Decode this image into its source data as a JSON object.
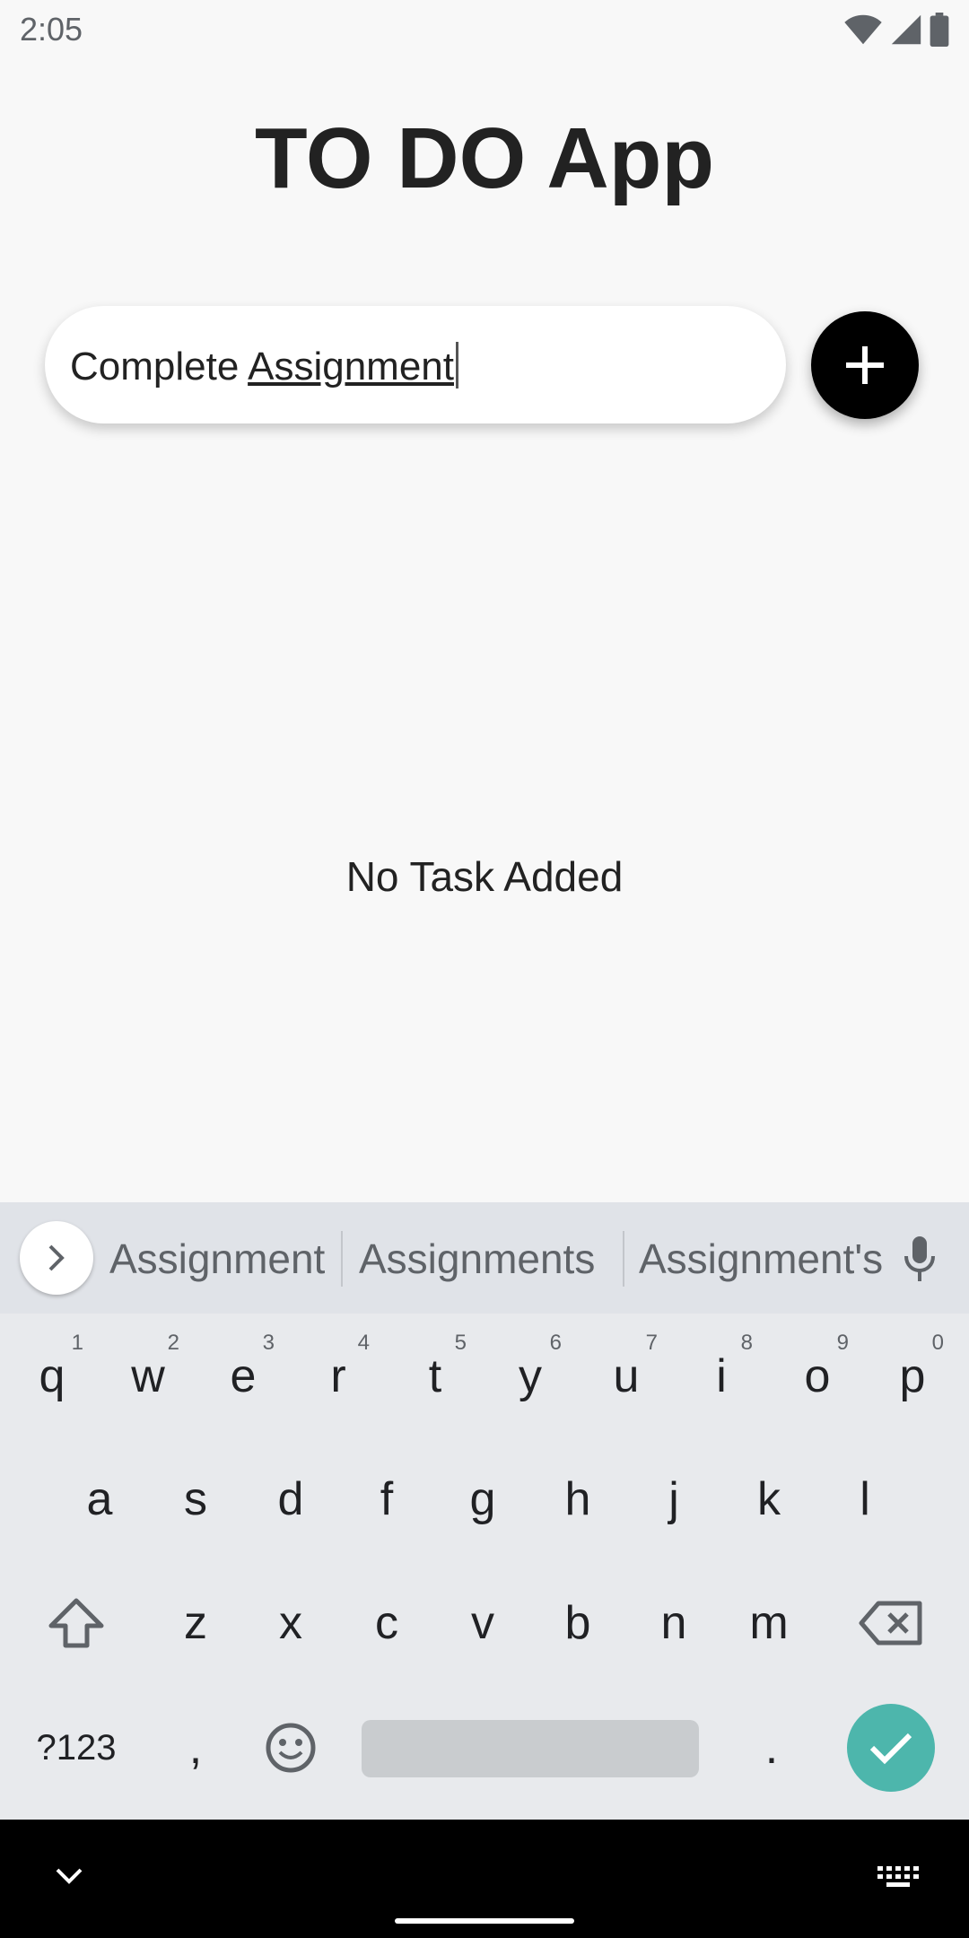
{
  "status_bar": {
    "time": "2:05",
    "icons": [
      "wifi-icon",
      "signal-icon",
      "battery-icon"
    ]
  },
  "app": {
    "title": "TO DO App",
    "input": {
      "typed_prefix": "Complete ",
      "composing_word": "Assignment"
    },
    "add_button_icon": "plus-icon",
    "empty_message": "No Task Added"
  },
  "keyboard": {
    "suggestions": [
      "Assignment",
      "Assignments",
      "Assignment's"
    ],
    "row1": [
      {
        "key": "q",
        "hint": "1"
      },
      {
        "key": "w",
        "hint": "2"
      },
      {
        "key": "e",
        "hint": "3"
      },
      {
        "key": "r",
        "hint": "4"
      },
      {
        "key": "t",
        "hint": "5"
      },
      {
        "key": "y",
        "hint": "6"
      },
      {
        "key": "u",
        "hint": "7"
      },
      {
        "key": "i",
        "hint": "8"
      },
      {
        "key": "o",
        "hint": "9"
      },
      {
        "key": "p",
        "hint": "0"
      }
    ],
    "row2": [
      "a",
      "s",
      "d",
      "f",
      "g",
      "h",
      "j",
      "k",
      "l"
    ],
    "row3": [
      "z",
      "x",
      "c",
      "v",
      "b",
      "n",
      "m"
    ],
    "symbols_label": "?123",
    "comma_label": ",",
    "period_label": ".",
    "accent_color": "#4db6ac"
  }
}
